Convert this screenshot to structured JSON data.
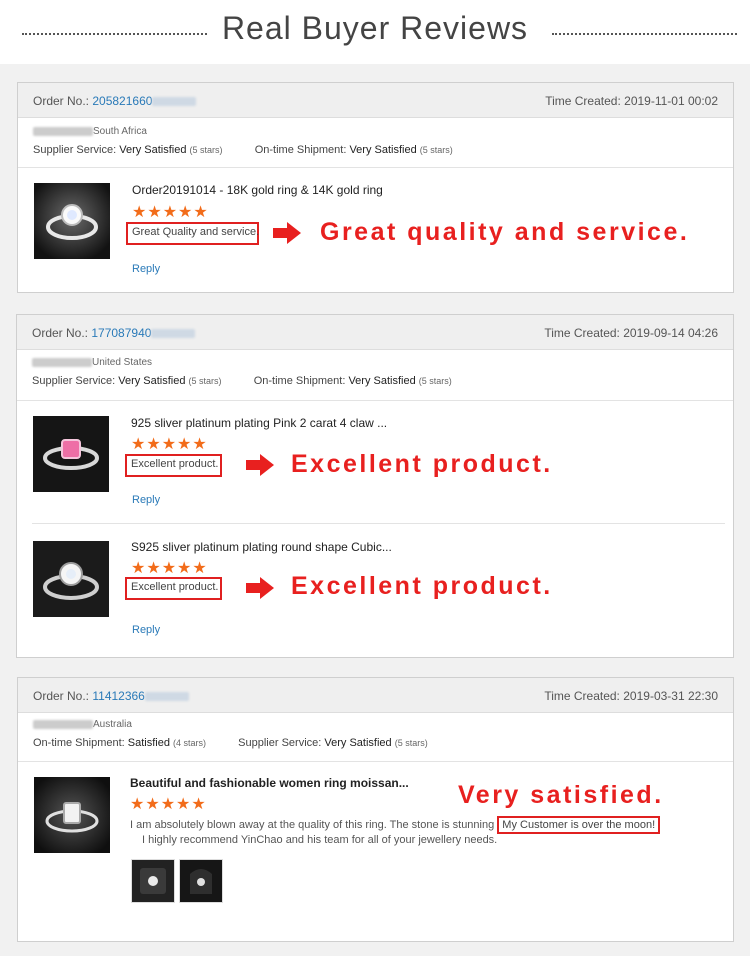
{
  "page_title": "Real Buyer Reviews",
  "colors": {
    "accent_red": "#e8201f",
    "star_orange": "#f26c1a",
    "link_blue": "#2a7ab8"
  },
  "reviews": [
    {
      "order_label": "Order No.:",
      "order_number": "205821660",
      "time_label": "Time Created:",
      "time": "2019-11-01 00:02",
      "buyer_country": "South Africa",
      "services": [
        {
          "label": "Supplier Service:",
          "value": "Very Satisfied",
          "stars": "(5 stars)"
        },
        {
          "label": "On-time Shipment:",
          "value": "Very Satisfied",
          "stars": "(5 stars)"
        }
      ],
      "items": [
        {
          "title": "Order20191014 - 18K gold ring & 14K gold ring",
          "stars": "★★★★★",
          "comment": "Great Quality and service.",
          "callout": "Great quality and service.",
          "reply": "Reply"
        }
      ]
    },
    {
      "order_label": "Order No.:",
      "order_number": "177087940",
      "time_label": "Time Created:",
      "time": "2019-09-14 04:26",
      "buyer_country": "United States",
      "services": [
        {
          "label": "Supplier Service:",
          "value": "Very Satisfied",
          "stars": "(5 stars)"
        },
        {
          "label": "On-time Shipment:",
          "value": "Very Satisfied",
          "stars": "(5 stars)"
        }
      ],
      "items": [
        {
          "title": "925 sliver platinum plating Pink 2 carat 4 claw ...",
          "stars": "★★★★★",
          "comment": "Excellent product.",
          "callout": "Excellent product.",
          "reply": "Reply"
        },
        {
          "title": "S925 sliver platinum plating round shape Cubic...",
          "stars": "★★★★★",
          "comment": "Excellent product.",
          "callout": "Excellent product.",
          "reply": "Reply"
        }
      ]
    },
    {
      "order_label": "Order No.:",
      "order_number": "11412366",
      "time_label": "Time Created:",
      "time": "2019-03-31 22:30",
      "buyer_country": "Australia",
      "services": [
        {
          "label": "On-time Shipment:",
          "value": "Satisfied",
          "stars": "(4 stars)"
        },
        {
          "label": "Supplier Service:",
          "value": "Very Satisfied",
          "stars": "(5 stars)"
        }
      ],
      "items": [
        {
          "title": "Beautiful and fashionable women ring moissan...",
          "stars": "★★★★★",
          "body_line1": "I am absolutely blown away at the quality of this ring. The stone is stunning",
          "body_highlight": "My Customer is over the moon!",
          "body_line2": "I highly recommend YinChao and his team for all of your jewellery needs.",
          "callout": "Very satisfied."
        }
      ]
    }
  ]
}
